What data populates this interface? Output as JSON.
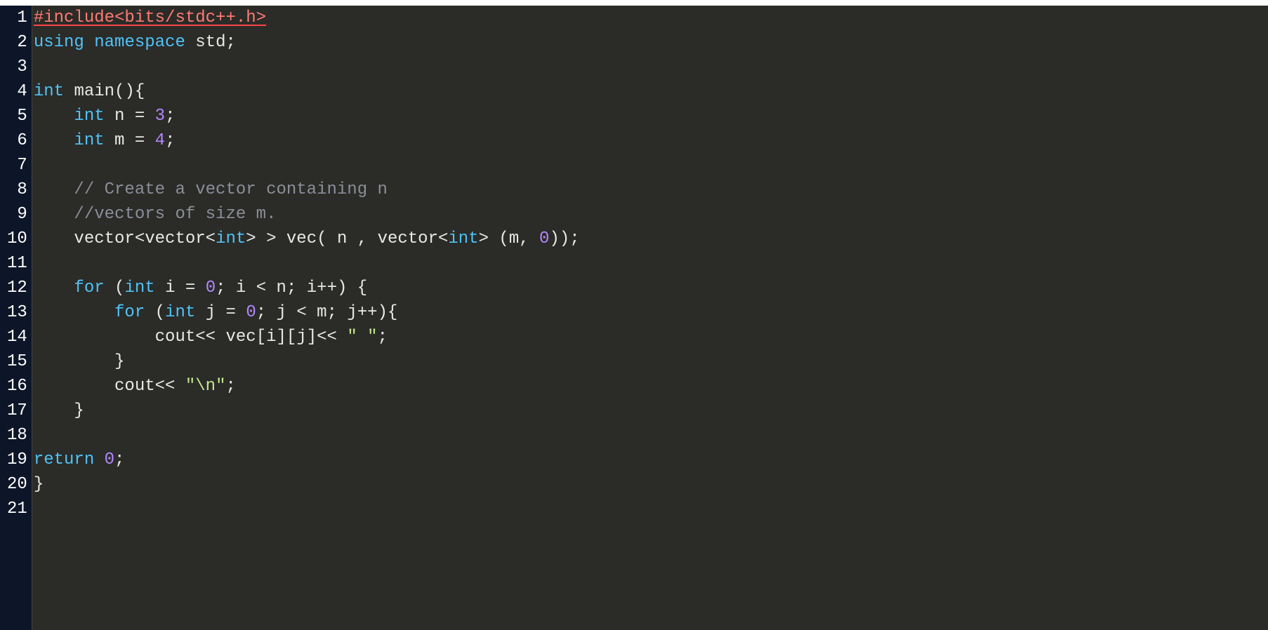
{
  "editor": {
    "lineNumbers": [
      "1",
      "2",
      "3",
      "4",
      "5",
      "6",
      "7",
      "8",
      "9",
      "10",
      "11",
      "12",
      "13",
      "14",
      "15",
      "16",
      "17",
      "18",
      "19",
      "20",
      "21"
    ],
    "lines": [
      {
        "tokens": [
          {
            "t": "#include<bits/stdc++.h>",
            "c": "tok-preproc error-underline"
          }
        ]
      },
      {
        "tokens": [
          {
            "t": "using",
            "c": "tok-keyword"
          },
          {
            "t": " ",
            "c": ""
          },
          {
            "t": "namespace",
            "c": "tok-keyword"
          },
          {
            "t": " ",
            "c": ""
          },
          {
            "t": "std",
            "c": "tok-ident"
          },
          {
            "t": ";",
            "c": "tok-punct"
          }
        ]
      },
      {
        "tokens": []
      },
      {
        "tokens": [
          {
            "t": "int",
            "c": "tok-keyword"
          },
          {
            "t": " ",
            "c": ""
          },
          {
            "t": "main",
            "c": "tok-ident"
          },
          {
            "t": "(){",
            "c": "tok-punct"
          }
        ]
      },
      {
        "tokens": [
          {
            "t": "    ",
            "c": ""
          },
          {
            "t": "int",
            "c": "tok-keyword"
          },
          {
            "t": " ",
            "c": ""
          },
          {
            "t": "n",
            "c": "tok-ident"
          },
          {
            "t": " = ",
            "c": "tok-op"
          },
          {
            "t": "3",
            "c": "tok-number"
          },
          {
            "t": ";",
            "c": "tok-punct"
          }
        ]
      },
      {
        "tokens": [
          {
            "t": "    ",
            "c": ""
          },
          {
            "t": "int",
            "c": "tok-keyword"
          },
          {
            "t": " ",
            "c": ""
          },
          {
            "t": "m",
            "c": "tok-ident"
          },
          {
            "t": " = ",
            "c": "tok-op"
          },
          {
            "t": "4",
            "c": "tok-number"
          },
          {
            "t": ";",
            "c": "tok-punct"
          }
        ]
      },
      {
        "tokens": []
      },
      {
        "tokens": [
          {
            "t": "    ",
            "c": ""
          },
          {
            "t": "// Create a vector containing n",
            "c": "tok-comment"
          }
        ]
      },
      {
        "tokens": [
          {
            "t": "    ",
            "c": ""
          },
          {
            "t": "//vectors of size m.",
            "c": "tok-comment"
          }
        ]
      },
      {
        "tokens": [
          {
            "t": "    ",
            "c": ""
          },
          {
            "t": "vector",
            "c": "tok-ident"
          },
          {
            "t": "<",
            "c": "tok-punct"
          },
          {
            "t": "vector",
            "c": "tok-ident"
          },
          {
            "t": "<",
            "c": "tok-punct"
          },
          {
            "t": "int",
            "c": "tok-keyword"
          },
          {
            "t": "> > ",
            "c": "tok-punct"
          },
          {
            "t": "vec",
            "c": "tok-ident"
          },
          {
            "t": "( ",
            "c": "tok-punct"
          },
          {
            "t": "n",
            "c": "tok-ident"
          },
          {
            "t": " , ",
            "c": "tok-punct"
          },
          {
            "t": "vector",
            "c": "tok-ident"
          },
          {
            "t": "<",
            "c": "tok-punct"
          },
          {
            "t": "int",
            "c": "tok-keyword"
          },
          {
            "t": "> (",
            "c": "tok-punct"
          },
          {
            "t": "m",
            "c": "tok-ident"
          },
          {
            "t": ", ",
            "c": "tok-punct"
          },
          {
            "t": "0",
            "c": "tok-number"
          },
          {
            "t": "));",
            "c": "tok-punct"
          }
        ]
      },
      {
        "tokens": []
      },
      {
        "tokens": [
          {
            "t": "    ",
            "c": ""
          },
          {
            "t": "for",
            "c": "tok-keyword"
          },
          {
            "t": " (",
            "c": "tok-punct"
          },
          {
            "t": "int",
            "c": "tok-keyword"
          },
          {
            "t": " ",
            "c": ""
          },
          {
            "t": "i",
            "c": "tok-ident"
          },
          {
            "t": " = ",
            "c": "tok-op"
          },
          {
            "t": "0",
            "c": "tok-number"
          },
          {
            "t": "; ",
            "c": "tok-punct"
          },
          {
            "t": "i",
            "c": "tok-ident"
          },
          {
            "t": " < ",
            "c": "tok-op"
          },
          {
            "t": "n",
            "c": "tok-ident"
          },
          {
            "t": "; ",
            "c": "tok-punct"
          },
          {
            "t": "i",
            "c": "tok-ident"
          },
          {
            "t": "++) {",
            "c": "tok-punct"
          }
        ]
      },
      {
        "tokens": [
          {
            "t": "        ",
            "c": ""
          },
          {
            "t": "for",
            "c": "tok-keyword"
          },
          {
            "t": " (",
            "c": "tok-punct"
          },
          {
            "t": "int",
            "c": "tok-keyword"
          },
          {
            "t": " ",
            "c": ""
          },
          {
            "t": "j",
            "c": "tok-ident"
          },
          {
            "t": " = ",
            "c": "tok-op"
          },
          {
            "t": "0",
            "c": "tok-number"
          },
          {
            "t": "; ",
            "c": "tok-punct"
          },
          {
            "t": "j",
            "c": "tok-ident"
          },
          {
            "t": " < ",
            "c": "tok-op"
          },
          {
            "t": "m",
            "c": "tok-ident"
          },
          {
            "t": "; ",
            "c": "tok-punct"
          },
          {
            "t": "j",
            "c": "tok-ident"
          },
          {
            "t": "++){",
            "c": "tok-punct"
          }
        ]
      },
      {
        "tokens": [
          {
            "t": "            ",
            "c": ""
          },
          {
            "t": "cout",
            "c": "tok-ident"
          },
          {
            "t": "<< ",
            "c": "tok-op"
          },
          {
            "t": "vec",
            "c": "tok-ident"
          },
          {
            "t": "[",
            "c": "tok-punct"
          },
          {
            "t": "i",
            "c": "tok-ident"
          },
          {
            "t": "][",
            "c": "tok-punct"
          },
          {
            "t": "j",
            "c": "tok-ident"
          },
          {
            "t": "]",
            "c": "tok-punct"
          },
          {
            "t": "<< ",
            "c": "tok-op"
          },
          {
            "t": "\" \"",
            "c": "tok-string"
          },
          {
            "t": ";",
            "c": "tok-punct"
          }
        ]
      },
      {
        "tokens": [
          {
            "t": "        }",
            "c": "tok-punct"
          }
        ]
      },
      {
        "tokens": [
          {
            "t": "        ",
            "c": ""
          },
          {
            "t": "cout",
            "c": "tok-ident"
          },
          {
            "t": "<< ",
            "c": "tok-op"
          },
          {
            "t": "\"\\n\"",
            "c": "tok-string"
          },
          {
            "t": ";",
            "c": "tok-punct"
          }
        ]
      },
      {
        "tokens": [
          {
            "t": "    }",
            "c": "tok-punct"
          }
        ]
      },
      {
        "tokens": []
      },
      {
        "tokens": [
          {
            "t": "return",
            "c": "tok-keyword"
          },
          {
            "t": " ",
            "c": ""
          },
          {
            "t": "0",
            "c": "tok-number"
          },
          {
            "t": ";",
            "c": "tok-punct"
          }
        ]
      },
      {
        "tokens": [
          {
            "t": "}",
            "c": "tok-punct"
          }
        ]
      },
      {
        "tokens": []
      }
    ]
  }
}
